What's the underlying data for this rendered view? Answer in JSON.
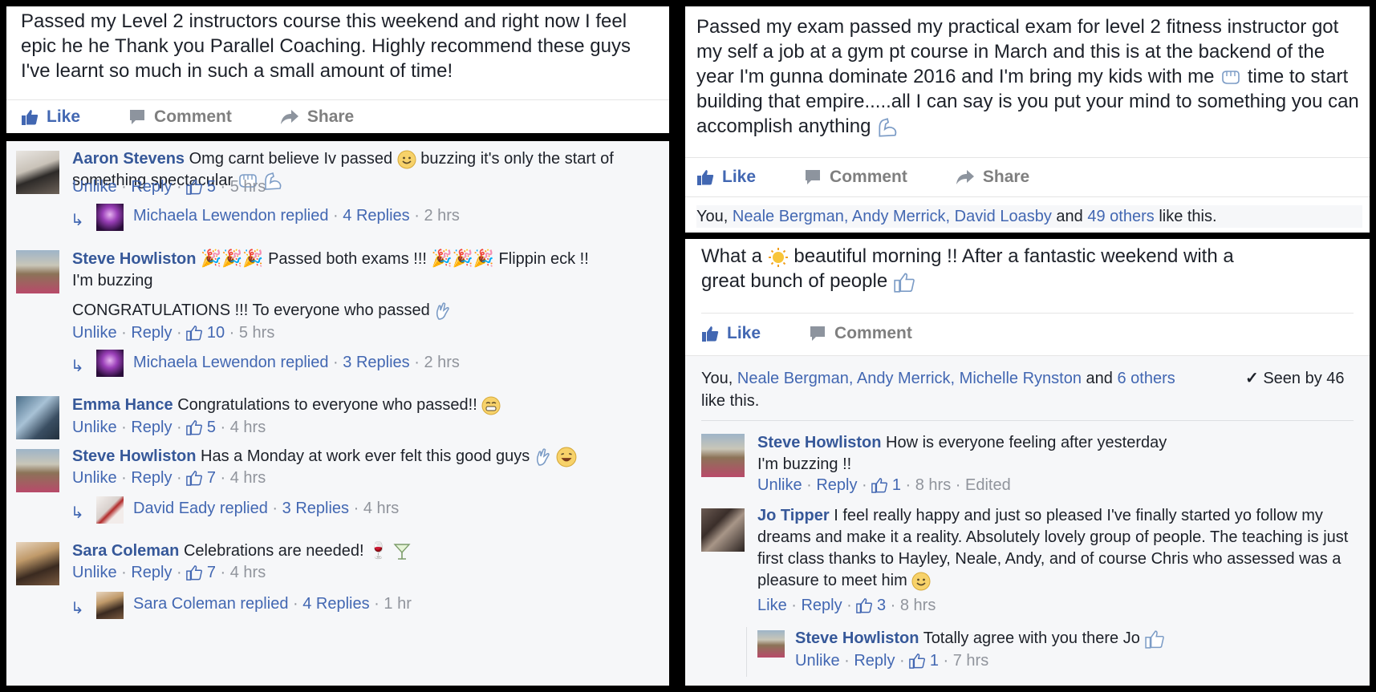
{
  "p1": {
    "text": "Passed my Level 2 instructors course this weekend and right now I feel epic he he Thank you Parallel Coaching. Highly recommend these guys I've learnt so much in such a small amount of time!",
    "like": "Like",
    "comment": "Comment",
    "share": "Share"
  },
  "p2": {
    "comments": [
      {
        "name": "Aaron Stevens",
        "text1": "Omg carnt believe Iv passed",
        "text2": "buzzing it's only the start of something spectacular",
        "unlike": "Unlike",
        "reply": "Reply",
        "likes": "5",
        "time": "5 hrs",
        "replied": {
          "who": "Michaela Lewendon replied",
          "count": "4 Replies",
          "time": "2 hrs"
        }
      },
      {
        "name": "Steve Howliston",
        "text1": "Passed both exams !!!",
        "text2": "Flippin eck !!",
        "text3": "I'm buzzing",
        "text4": "CONGRATULATIONS !!! To everyone who passed",
        "unlike": "Unlike",
        "reply": "Reply",
        "likes": "10",
        "time": "5 hrs",
        "replied": {
          "who": "Michaela Lewendon replied",
          "count": "3 Replies",
          "time": "2 hrs"
        }
      },
      {
        "name": "Emma Hance",
        "text1": "Congratulations to everyone who passed!!",
        "unlike": "Unlike",
        "reply": "Reply",
        "likes": "5",
        "time": "4 hrs"
      },
      {
        "name": "Steve Howliston",
        "text1": "Has a Monday at work ever felt this good guys",
        "unlike": "Unlike",
        "reply": "Reply",
        "likes": "7",
        "time": "4 hrs",
        "replied": {
          "who": "David Eady replied",
          "count": "3 Replies",
          "time": "4 hrs"
        }
      },
      {
        "name": "Sara Coleman",
        "text1": "Celebrations are needed!",
        "unlike": "Unlike",
        "reply": "Reply",
        "likes": "7",
        "time": "4 hrs",
        "replied": {
          "who": "Sara Coleman replied",
          "count": "4 Replies",
          "time": "1 hr"
        }
      }
    ]
  },
  "p3": {
    "text1": "Passed my exam passed my practical exam for level 2 fitness instructor got my self a job at a gym pt course in March and this is at the backend of the year I'm gunna dominate 2016 and I'm bring my kids with me",
    "text2": "time to start building that empire.....all I can say is you put your mind to something you can accomplish anything",
    "like": "Like",
    "comment": "Comment",
    "share": "Share",
    "likers": {
      "you": "You,",
      "n1": "Neale Bergman,",
      "n2": "Andy Merrick,",
      "n3": "David Loasby",
      "and": "and",
      "others": "49 others",
      "tail": "like this."
    }
  },
  "p4": {
    "text1": "What a",
    "text2": "beautiful morning !! After a fantastic weekend with a great bunch of people",
    "like": "Like",
    "comment": "Comment",
    "likers": {
      "you": "You,",
      "n1": "Neale Bergman,",
      "n2": "Andy Merrick,",
      "n3": "Michelle Rynston",
      "and": "and",
      "others": "6 others",
      "tail": "like this."
    },
    "seen": "Seen by 46",
    "comments": [
      {
        "name": "Steve Howliston",
        "text1": "How is everyone feeling after yesterday",
        "text2": "I'm buzzing !!",
        "unlike": "Unlike",
        "reply": "Reply",
        "likes": "1",
        "time": "8 hrs",
        "edited": "Edited"
      },
      {
        "name": "Jo Tipper",
        "text1": "I feel really happy and just so pleased I've finally started yo follow my dreams and make it a reality. Absolutely lovely group of people. The teaching is just first class thanks to Hayley, Neale, Andy, and of course Chris who assessed was a pleasure to meet him",
        "like": "Like",
        "reply": "Reply",
        "likes": "3",
        "time": "8 hrs"
      },
      {
        "name": "Steve Howliston",
        "text1": "Totally agree with you there Jo",
        "unlike": "Unlike",
        "reply": "Reply",
        "likes": "1",
        "time": "7 hrs"
      }
    ]
  },
  "colors": {
    "link": "#4267b2",
    "name": "#365899",
    "grey": "#90949c",
    "text": "#1d2129"
  }
}
